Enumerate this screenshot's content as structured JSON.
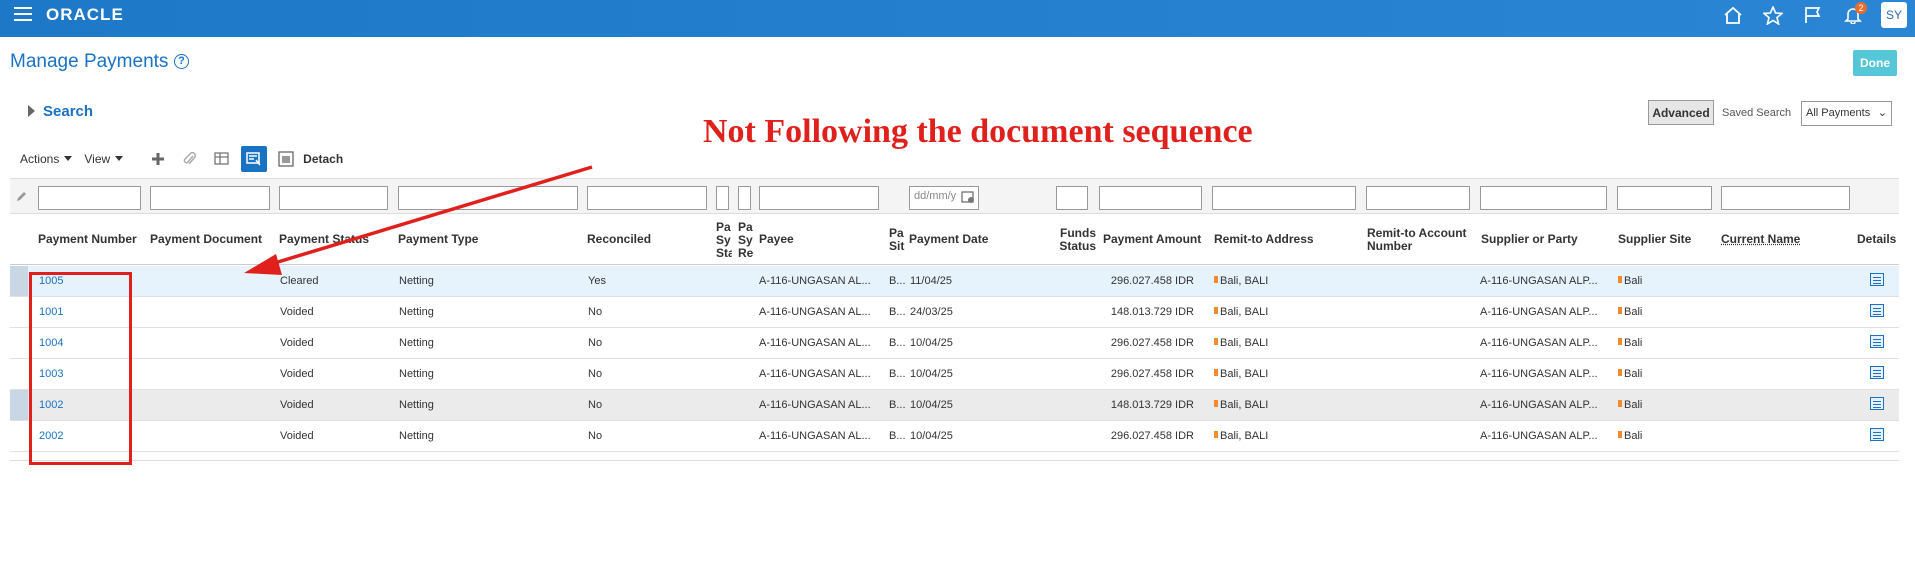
{
  "app": {
    "logo": "ORACLE",
    "user_initials": "SY",
    "notification_count": "2"
  },
  "page": {
    "title": "Manage Payments",
    "help": "?",
    "done_label": "Done"
  },
  "search": {
    "toggle_label": "Search",
    "advanced_label": "Advanced",
    "saved_search_label": "Saved Search",
    "saved_search_value": "All Payments"
  },
  "annotation": {
    "text": "Not Following the document sequence"
  },
  "toolbar": {
    "actions_label": "Actions",
    "view_label": "View",
    "detach_label": "Detach"
  },
  "filter": {
    "date_placeholder": "dd/mm/y"
  },
  "columns": [
    "Payment Number",
    "Payment Document",
    "Payment Status",
    "Payment Type",
    "Reconciled",
    "Pa Sy Sta",
    "Pa Sy Re",
    "Payee",
    "Pa Sit",
    "Payment Date",
    "Funds Status",
    "Payment Amount",
    "Remit-to Address",
    "Remit-to Account Number",
    "Supplier or Party",
    "Supplier Site",
    "Current Name",
    "Details"
  ],
  "rows": [
    {
      "number": "1005",
      "status": "Cleared",
      "type": "Netting",
      "reconciled": "Yes",
      "payee": "A-116-UNGASAN AL...",
      "site": "B...",
      "date": "11/04/25",
      "amount": "296.027.458 IDR",
      "address": "Bali, BALI",
      "supplier": "A-116-UNGASAN ALP...",
      "supplier_site": "Bali"
    },
    {
      "number": "1001",
      "status": "Voided",
      "type": "Netting",
      "reconciled": "No",
      "payee": "A-116-UNGASAN AL...",
      "site": "B...",
      "date": "24/03/25",
      "amount": "148.013.729 IDR",
      "address": "Bali, BALI",
      "supplier": "A-116-UNGASAN ALP...",
      "supplier_site": "Bali"
    },
    {
      "number": "1004",
      "status": "Voided",
      "type": "Netting",
      "reconciled": "No",
      "payee": "A-116-UNGASAN AL...",
      "site": "B...",
      "date": "10/04/25",
      "amount": "296.027.458 IDR",
      "address": "Bali, BALI",
      "supplier": "A-116-UNGASAN ALP...",
      "supplier_site": "Bali"
    },
    {
      "number": "1003",
      "status": "Voided",
      "type": "Netting",
      "reconciled": "No",
      "payee": "A-116-UNGASAN AL...",
      "site": "B...",
      "date": "10/04/25",
      "amount": "296.027.458 IDR",
      "address": "Bali, BALI",
      "supplier": "A-116-UNGASAN ALP...",
      "supplier_site": "Bali"
    },
    {
      "number": "1002",
      "status": "Voided",
      "type": "Netting",
      "reconciled": "No",
      "payee": "A-116-UNGASAN AL...",
      "site": "B...",
      "date": "10/04/25",
      "amount": "148.013.729 IDR",
      "address": "Bali, BALI",
      "supplier": "A-116-UNGASAN ALP...",
      "supplier_site": "Bali"
    },
    {
      "number": "2002",
      "status": "Voided",
      "type": "Netting",
      "reconciled": "No",
      "payee": "A-116-UNGASAN AL...",
      "site": "B...",
      "date": "10/04/25",
      "amount": "296.027.458 IDR",
      "address": "Bali, BALI",
      "supplier": "A-116-UNGASAN ALP...",
      "supplier_site": "Bali"
    }
  ],
  "colors": {
    "header_bar": "#1e78c8",
    "link": "#1a72c4",
    "annotation": "#e0201c",
    "done": "#56c7d8"
  }
}
